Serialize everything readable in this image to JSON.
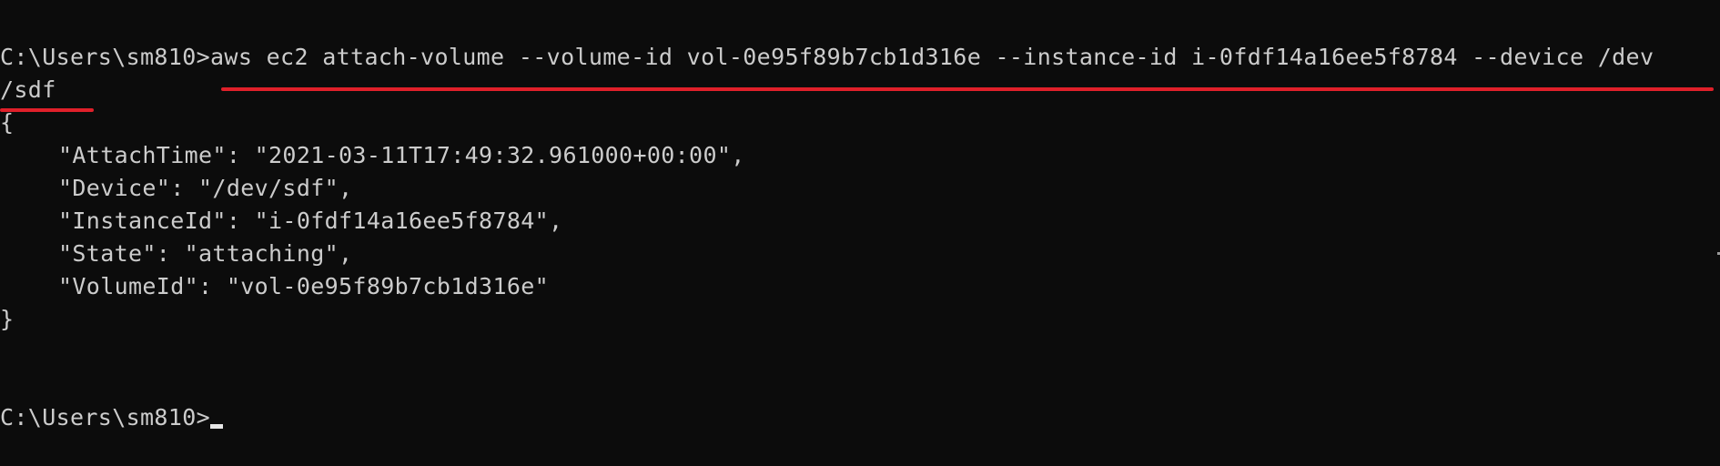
{
  "terminal": {
    "prompt": "C:\\Users\\sm810>",
    "command_line1": "aws ec2 attach-volume --volume-id vol-0e95f89b7cb1d316e --instance-id i-0fdf14a16ee5f8784 --device /dev",
    "command_line2": "/sdf",
    "output": {
      "open_brace": "{",
      "attach_time": "\"AttachTime\": \"2021-03-11T17:49:32.961000+00:00\",",
      "device": "\"Device\": \"/dev/sdf\",",
      "instance_id": "\"InstanceId\": \"i-0fdf14a16ee5f8784\",",
      "state": "\"State\": \"attaching\",",
      "volume_id": "\"VolumeId\": \"vol-0e95f89b7cb1d316e\"",
      "close_brace": "}"
    },
    "final_prompt": "C:\\Users\\sm810>",
    "colors": {
      "background": "#0c0c0c",
      "text": "#cccccc",
      "annotation_underline": "#e0202a"
    }
  }
}
